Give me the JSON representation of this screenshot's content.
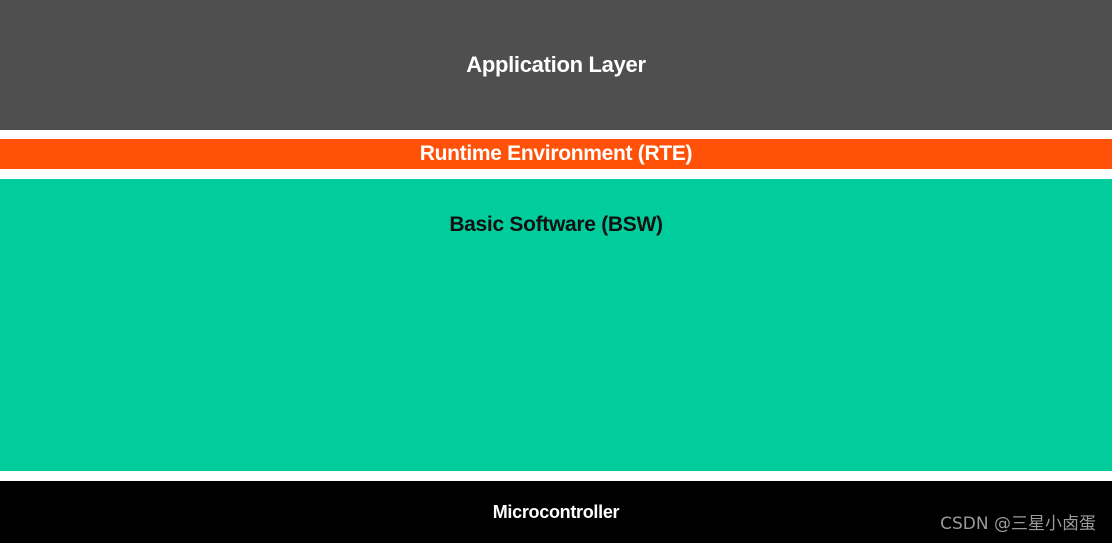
{
  "layers": {
    "application": {
      "label": "Application Layer",
      "color": "#4f4f4f"
    },
    "rte": {
      "label": "Runtime Environment (RTE)",
      "color": "#ff5208"
    },
    "bsw": {
      "label": "Basic Software (BSW)",
      "color": "#00cc9c"
    },
    "microcontroller": {
      "label": "Microcontroller",
      "color": "#000000"
    }
  },
  "watermark": {
    "text": "CSDN @三星小卤蛋"
  }
}
